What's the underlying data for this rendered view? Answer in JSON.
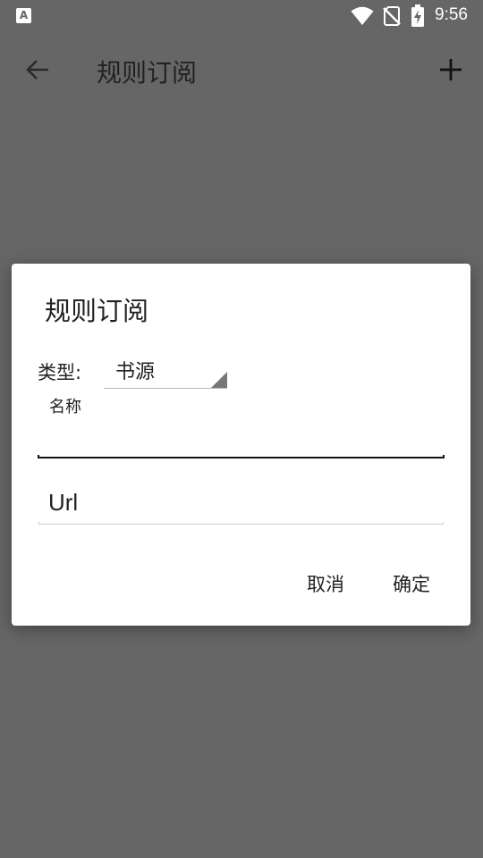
{
  "status_bar": {
    "time": "9:56",
    "notification_icon": "A"
  },
  "toolbar": {
    "title": "规则订阅"
  },
  "dialog": {
    "title": "规则订阅",
    "type_label": "类型:",
    "type_value": "书源",
    "name_hint": "名称",
    "name_value": "",
    "url_placeholder": "Url",
    "cancel_label": "取消",
    "ok_label": "确定"
  }
}
